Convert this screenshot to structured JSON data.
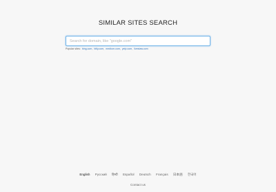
{
  "header": {
    "title": "SIMILAR SITES SEARCH"
  },
  "search": {
    "placeholder": "Search for domain, like \"google.com\"",
    "value": ""
  },
  "popular": {
    "label": "Popular sites:",
    "sites": [
      "bing.com",
      "bitly.com",
      "medium.com",
      "yelp.com",
      "livestaw.com"
    ]
  },
  "footer": {
    "languages": [
      "English",
      "Русский",
      "हिन्दी",
      "Español",
      "Deutsch",
      "Français",
      "日本語",
      "한국어"
    ],
    "active_language": "English",
    "contact": "Contact us"
  },
  "colors": {
    "background": "#f7f7f7",
    "input_border": "#6fb3e8",
    "link": "#2a6fb8"
  }
}
